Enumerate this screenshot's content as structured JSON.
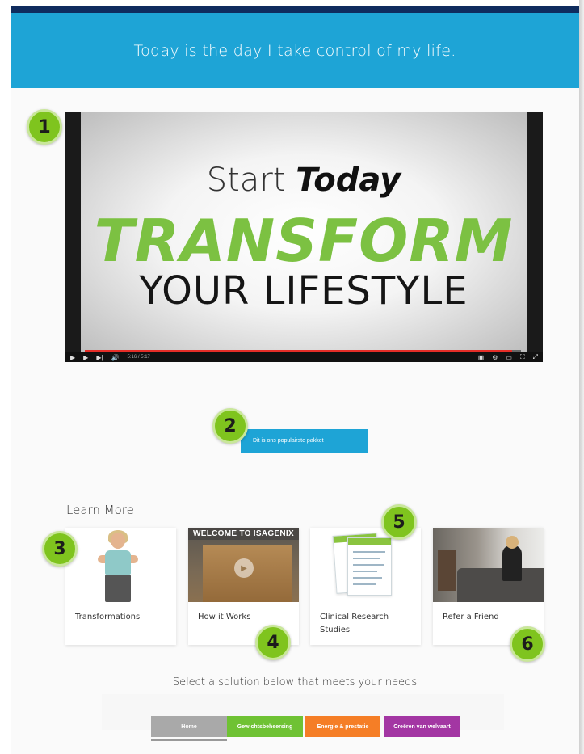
{
  "hero": {
    "text": "Today is the day I take control of my life."
  },
  "video": {
    "title_line1": "Start",
    "title_line1_bold": "Today",
    "title_line2": "TRANSFORM",
    "title_line3": "YOUR LIFESTYLE",
    "time": "5:16 / 5:17",
    "progress": 0.98
  },
  "cta": {
    "label": "Dit is ons populairste pakket"
  },
  "learn_more": {
    "title": "Learn More",
    "cards": [
      {
        "label": "Transformations"
      },
      {
        "label": "How it Works",
        "image_text": "WELCOME TO ISAGENIX"
      },
      {
        "label": "Clinical Research Studies"
      },
      {
        "label": "Refer a Friend"
      }
    ]
  },
  "badges": [
    "1",
    "2",
    "3",
    "4",
    "5",
    "6"
  ],
  "solutions": {
    "title": "Select a solution below that meets your needs",
    "buttons": [
      "Home",
      "Gewichtsbeheersing",
      "Energie & prestatie",
      "Creëren van welvaart"
    ]
  },
  "colors": {
    "hero": "#1ea4d6",
    "topbar": "#0f2c5e",
    "badge": "#7fc41e",
    "green": "#6fc234",
    "orange": "#f57e26",
    "purple": "#a336a3",
    "grey": "#a9a9a9"
  }
}
